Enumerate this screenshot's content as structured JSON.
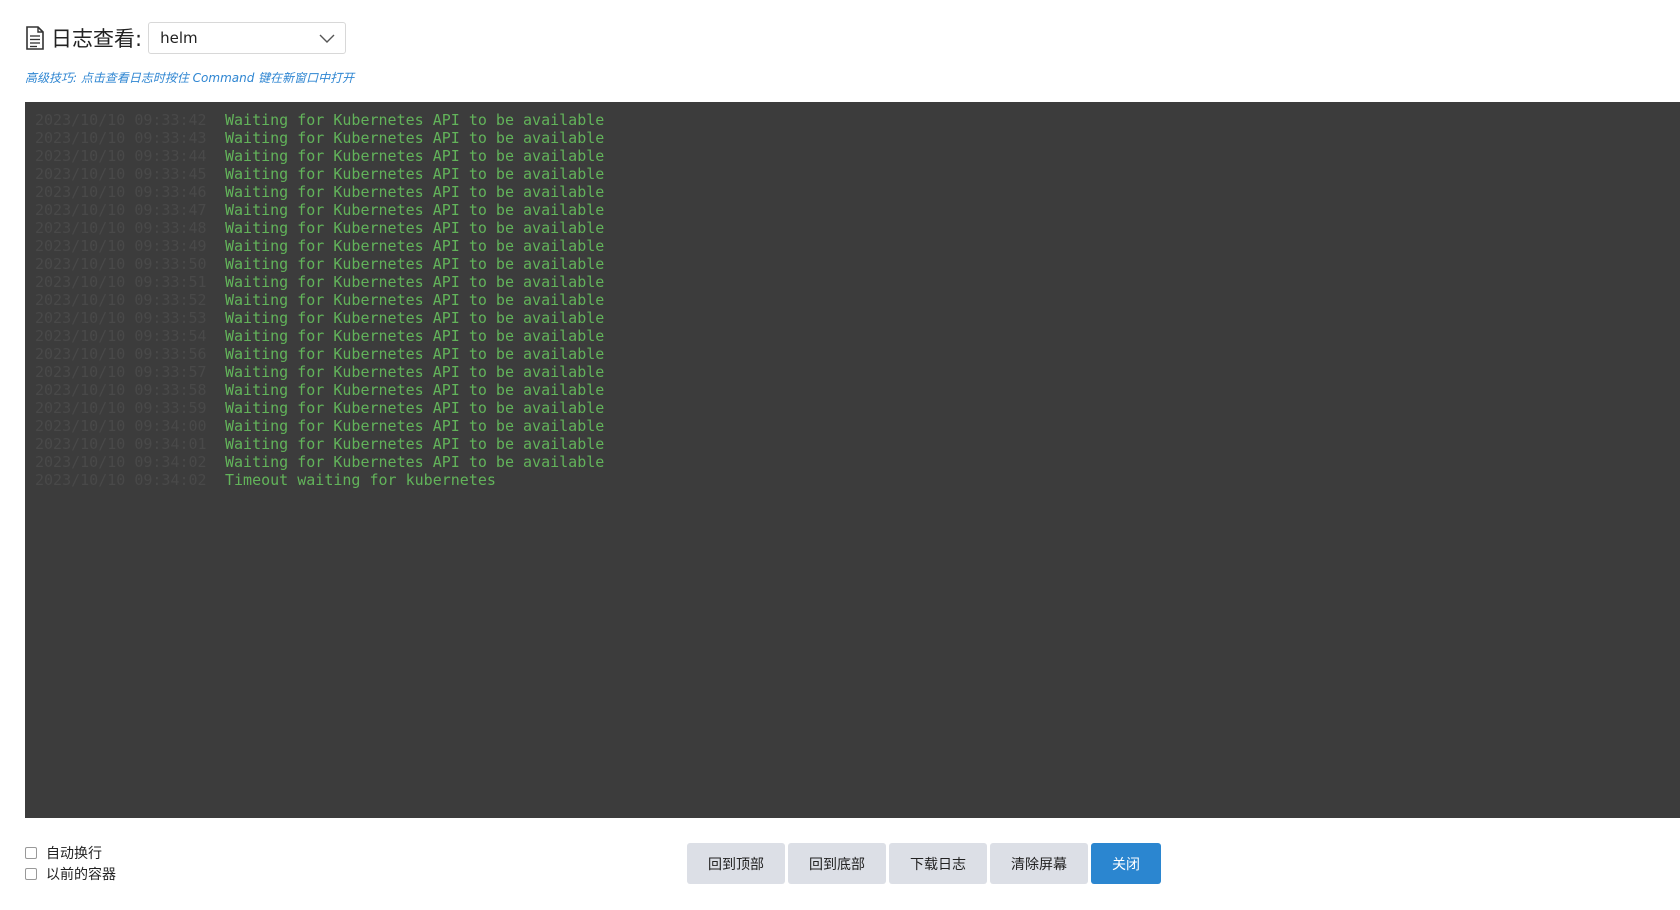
{
  "header": {
    "icon": "document-icon",
    "title": "日志查看:",
    "container_select": {
      "value": "helm",
      "icon": "chevron-down-icon"
    }
  },
  "tip": "高级技巧: 点击查看日志时按住 Command 键在新窗口中打开",
  "log": {
    "colors": {
      "background": "#3c3c3c",
      "timestamp": "#494949",
      "message": "#62b35a"
    },
    "lines": [
      {
        "ts": "2023/10/10 09:33:42",
        "msg": "Waiting for Kubernetes API to be available"
      },
      {
        "ts": "2023/10/10 09:33:43",
        "msg": "Waiting for Kubernetes API to be available"
      },
      {
        "ts": "2023/10/10 09:33:44",
        "msg": "Waiting for Kubernetes API to be available"
      },
      {
        "ts": "2023/10/10 09:33:45",
        "msg": "Waiting for Kubernetes API to be available"
      },
      {
        "ts": "2023/10/10 09:33:46",
        "msg": "Waiting for Kubernetes API to be available"
      },
      {
        "ts": "2023/10/10 09:33:47",
        "msg": "Waiting for Kubernetes API to be available"
      },
      {
        "ts": "2023/10/10 09:33:48",
        "msg": "Waiting for Kubernetes API to be available"
      },
      {
        "ts": "2023/10/10 09:33:49",
        "msg": "Waiting for Kubernetes API to be available"
      },
      {
        "ts": "2023/10/10 09:33:50",
        "msg": "Waiting for Kubernetes API to be available"
      },
      {
        "ts": "2023/10/10 09:33:51",
        "msg": "Waiting for Kubernetes API to be available"
      },
      {
        "ts": "2023/10/10 09:33:52",
        "msg": "Waiting for Kubernetes API to be available"
      },
      {
        "ts": "2023/10/10 09:33:53",
        "msg": "Waiting for Kubernetes API to be available"
      },
      {
        "ts": "2023/10/10 09:33:54",
        "msg": "Waiting for Kubernetes API to be available"
      },
      {
        "ts": "2023/10/10 09:33:56",
        "msg": "Waiting for Kubernetes API to be available"
      },
      {
        "ts": "2023/10/10 09:33:57",
        "msg": "Waiting for Kubernetes API to be available"
      },
      {
        "ts": "2023/10/10 09:33:58",
        "msg": "Waiting for Kubernetes API to be available"
      },
      {
        "ts": "2023/10/10 09:33:59",
        "msg": "Waiting for Kubernetes API to be available"
      },
      {
        "ts": "2023/10/10 09:34:00",
        "msg": "Waiting for Kubernetes API to be available"
      },
      {
        "ts": "2023/10/10 09:34:01",
        "msg": "Waiting for Kubernetes API to be available"
      },
      {
        "ts": "2023/10/10 09:34:02",
        "msg": "Waiting for Kubernetes API to be available"
      },
      {
        "ts": "2023/10/10 09:34:02",
        "msg": "Timeout waiting for kubernetes"
      }
    ]
  },
  "options": {
    "wrap_label": "自动换行",
    "previous_label": "以前的容器"
  },
  "buttons": {
    "top": "回到顶部",
    "bottom": "回到底部",
    "download": "下载日志",
    "clear": "清除屏幕",
    "close": "关闭"
  },
  "colors": {
    "accent": "#2b86d0",
    "tip": "#2f86d2"
  }
}
